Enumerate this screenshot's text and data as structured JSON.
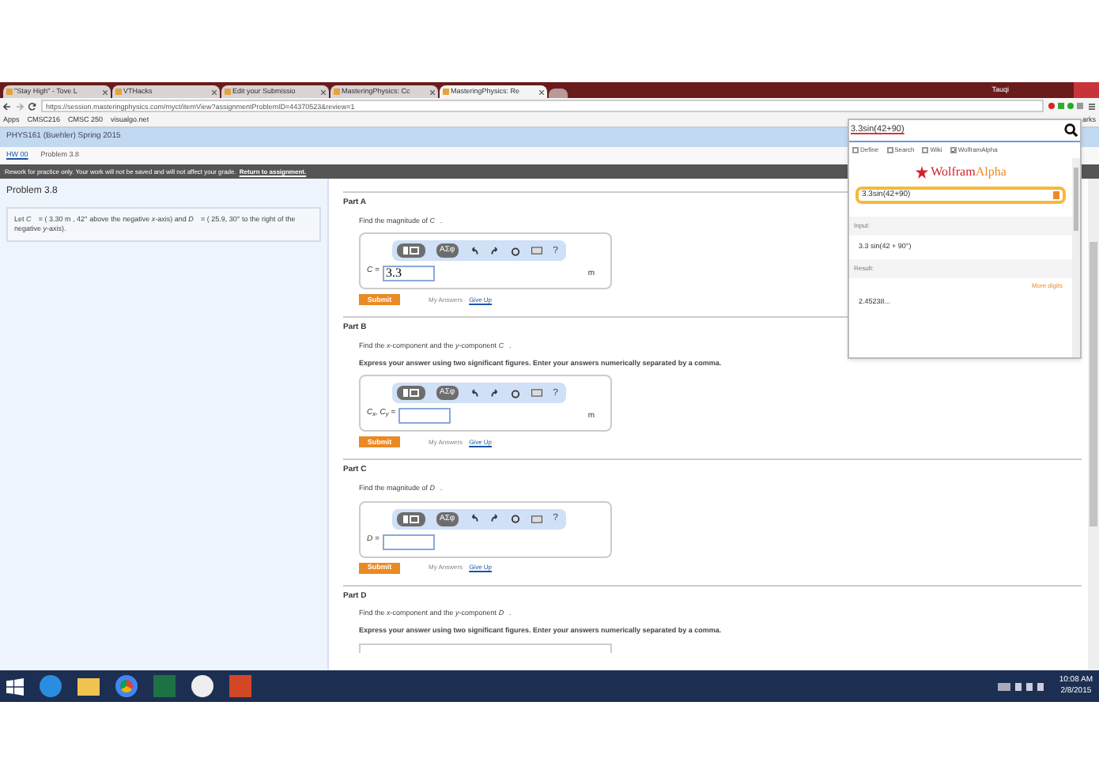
{
  "browser": {
    "tabs": [
      {
        "title": "\"Stay High\" - Tove L",
        "selected": false
      },
      {
        "title": "VTHacks",
        "selected": false
      },
      {
        "title": "Edit your Submissio",
        "selected": false
      },
      {
        "title": "MasteringPhysics: Cc",
        "selected": false
      },
      {
        "title": "MasteringPhysics: Re",
        "selected": true
      }
    ],
    "user": "Tauqi",
    "address": "https://session.masteringphysics.com/myct/itemView?assignmentProblemID=44370523&review=1",
    "bookmarks": [
      "Apps",
      "CMSC216",
      "CMSC 250",
      "visualgo.net"
    ],
    "bookmarks_right": "arks"
  },
  "course": "PHYS161 (Buehler) Spring 2015",
  "breadcrumb": [
    "HW 00",
    "Problem 3.8"
  ],
  "banner": {
    "text": "Rework for practice only. Your work will not be saved and will not affect your grade.",
    "link": "Return to assignment."
  },
  "problem": {
    "title": "Problem 3.8",
    "statement": "Let *C⃗* = ( 3.30 m , 42° above the negative *x*-axis) and *D⃗* = ( 25.9, 30° to the right of the negative *y*-axis)."
  },
  "parts": [
    {
      "title": "Part A",
      "prompt": "Find the magnitude of *C⃗*.",
      "toolbar": {
        "symbols": "ΑΣφ",
        "help": "?"
      },
      "label": "*C* =",
      "value": "3.3",
      "unit": "m",
      "submit": "Submit",
      "my_answers": "My Answers",
      "give_up": "Give Up"
    },
    {
      "title": "Part B",
      "prompt": "Find the *x*-component and the *y*-component *C⃗*.",
      "instruction": "Express your answer using two significant figures. Enter your answers numerically separated by a comma.",
      "toolbar": {
        "symbols": "ΑΣφ",
        "help": "?"
      },
      "label": "*C*$_{x}$, *C*$_{y}$ =",
      "unit": "m",
      "submit": "Submit",
      "my_answers": "My Answers",
      "give_up": "Give Up"
    },
    {
      "title": "Part C",
      "prompt": "Find the magnitude of *D⃗*.",
      "toolbar": {
        "symbols": "ΑΣφ",
        "help": "?"
      },
      "label": "*D* =",
      "submit": "Submit",
      "my_answers": "My Answers",
      "give_up": "Give Up"
    },
    {
      "title": "Part D",
      "prompt": "Find the *x*-component and the *y*-component *D⃗*.",
      "instruction": "Express your answer using two significant figures. Enter your answers numerically separated by a comma."
    }
  ],
  "wolfram": {
    "query": "3.3sin(42+90)",
    "options": [
      {
        "label": "Define",
        "checked": false
      },
      {
        "label": "Search",
        "checked": false
      },
      {
        "label": "Wiki",
        "checked": false
      },
      {
        "label": "WolframAlpha",
        "checked": true
      }
    ],
    "logo": "Wolfram",
    "logo_accent": "Alpha",
    "input_box": "3.3sin(42+90)",
    "input_heading": "Input:",
    "input": "3.3 sin(42 + 90°)",
    "result_heading": "Result:",
    "more": "More digits",
    "result": "2.45238..."
  },
  "taskbar": {
    "time": "10:08 AM",
    "date": "2/8/2015"
  }
}
